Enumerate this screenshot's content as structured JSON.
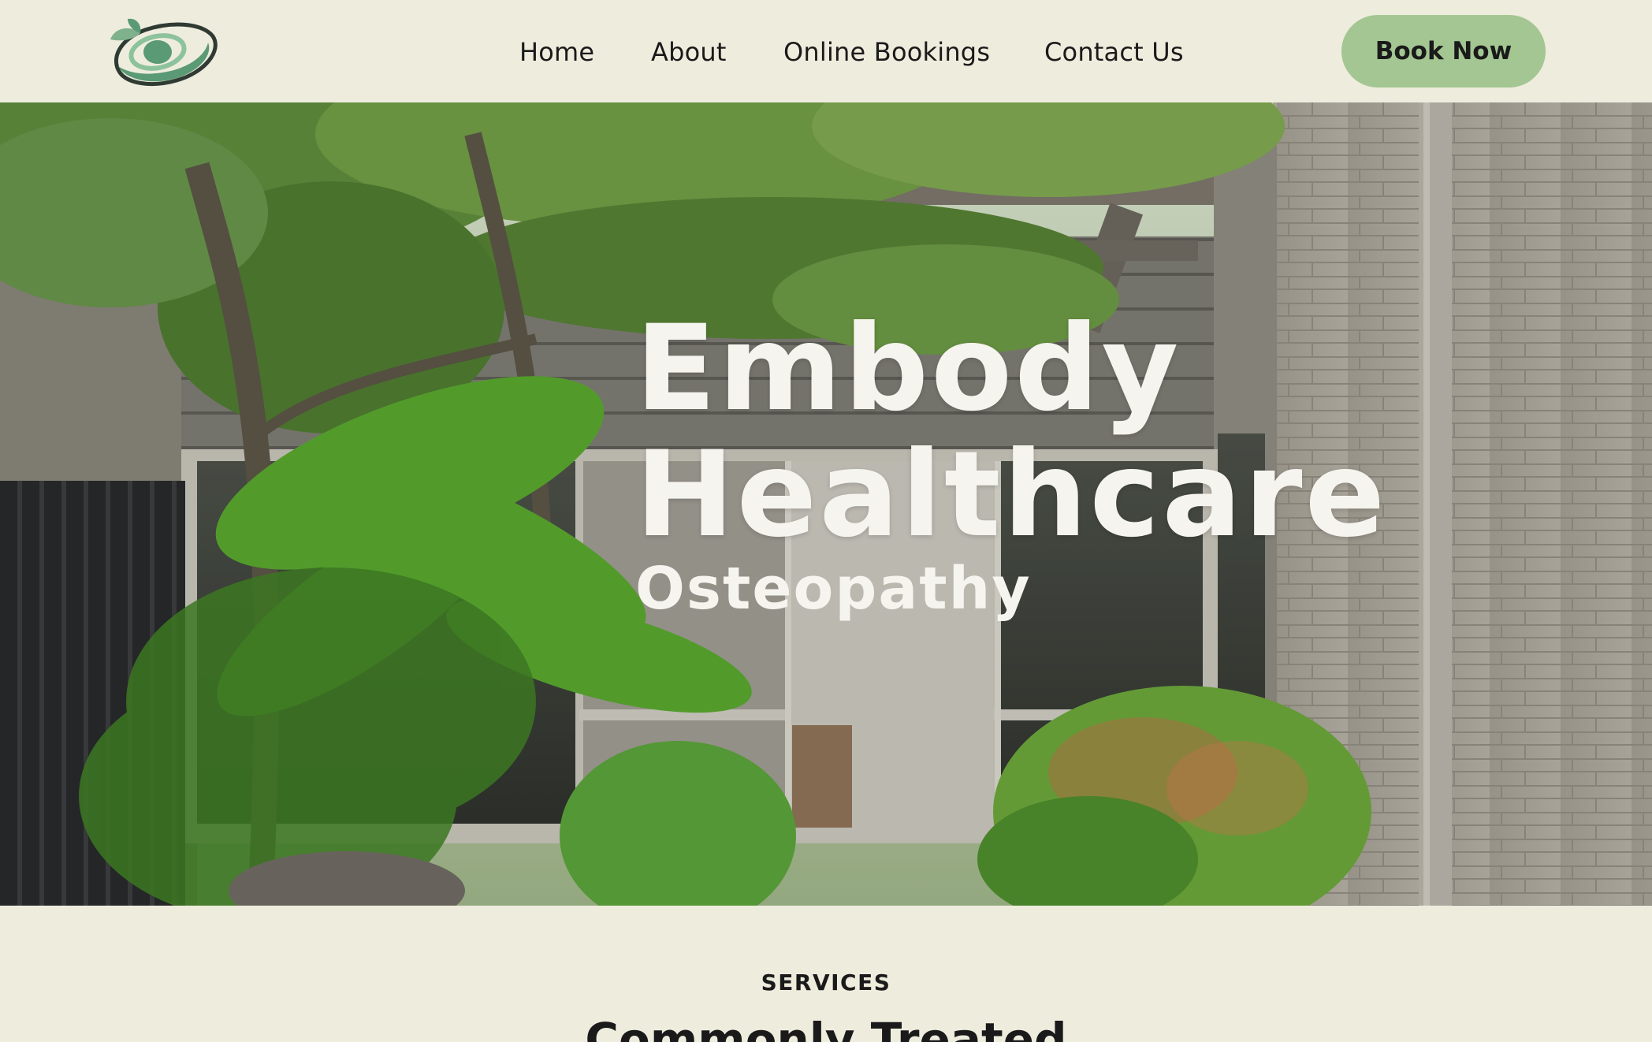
{
  "header": {
    "logo_name": "embody-logo-icon",
    "nav": [
      {
        "label": "Home"
      },
      {
        "label": "About"
      },
      {
        "label": "Online Bookings"
      },
      {
        "label": "Contact Us"
      }
    ],
    "cta_label": "Book Now"
  },
  "hero": {
    "title_line1": "Embody",
    "title_line2": "Healthcare",
    "subtitle": "Osteopathy",
    "image": "clinic-courtyard-entrance-photo"
  },
  "services": {
    "eyebrow": "SERVICES",
    "heading": "Commonly Treated"
  },
  "colors": {
    "background": "#eeecdd",
    "accent": "#a3c693",
    "logo_dark": "#2f3a33",
    "logo_green": "#5a9a74",
    "text": "#1a1a1a",
    "hero_text": "#f5f4ee"
  }
}
